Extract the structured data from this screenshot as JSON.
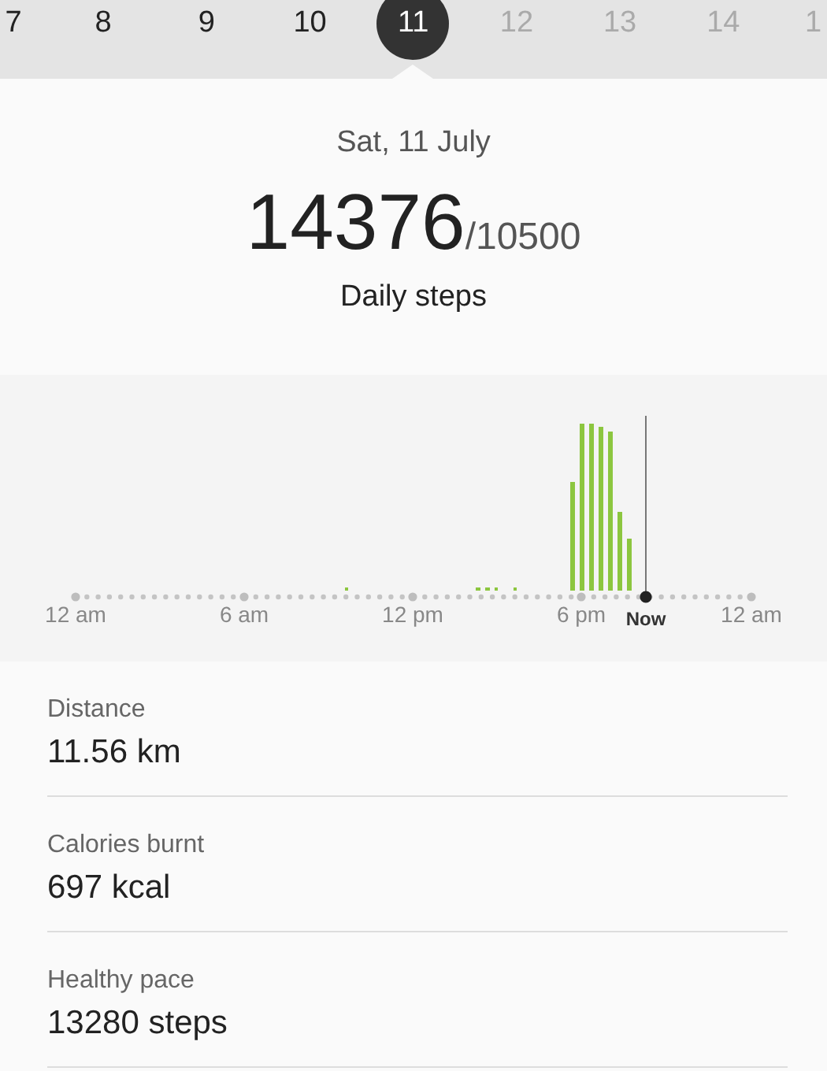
{
  "date_strip": [
    {
      "label": "7",
      "selected": false,
      "disabled": false
    },
    {
      "label": "8",
      "selected": false,
      "disabled": false
    },
    {
      "label": "9",
      "selected": false,
      "disabled": false
    },
    {
      "label": "10",
      "selected": false,
      "disabled": false
    },
    {
      "label": "11",
      "selected": true,
      "disabled": false
    },
    {
      "label": "12",
      "selected": false,
      "disabled": true
    },
    {
      "label": "13",
      "selected": false,
      "disabled": true
    },
    {
      "label": "14",
      "selected": false,
      "disabled": true
    },
    {
      "label": "1",
      "selected": false,
      "disabled": true
    }
  ],
  "summary": {
    "date": "Sat, 11 July",
    "steps": "14376",
    "goal": "/10500",
    "caption": "Daily steps"
  },
  "activity_chart": {
    "axis_labels": [
      "12 am",
      "6 am",
      "12 pm",
      "6 pm",
      "12 am"
    ],
    "now_label": "Now"
  },
  "stats": [
    {
      "label": "Distance",
      "value": "11.56 km"
    },
    {
      "label": "Calories burnt",
      "value": "697 kcal"
    },
    {
      "label": "Healthy pace",
      "value": "13280 steps"
    }
  ]
}
